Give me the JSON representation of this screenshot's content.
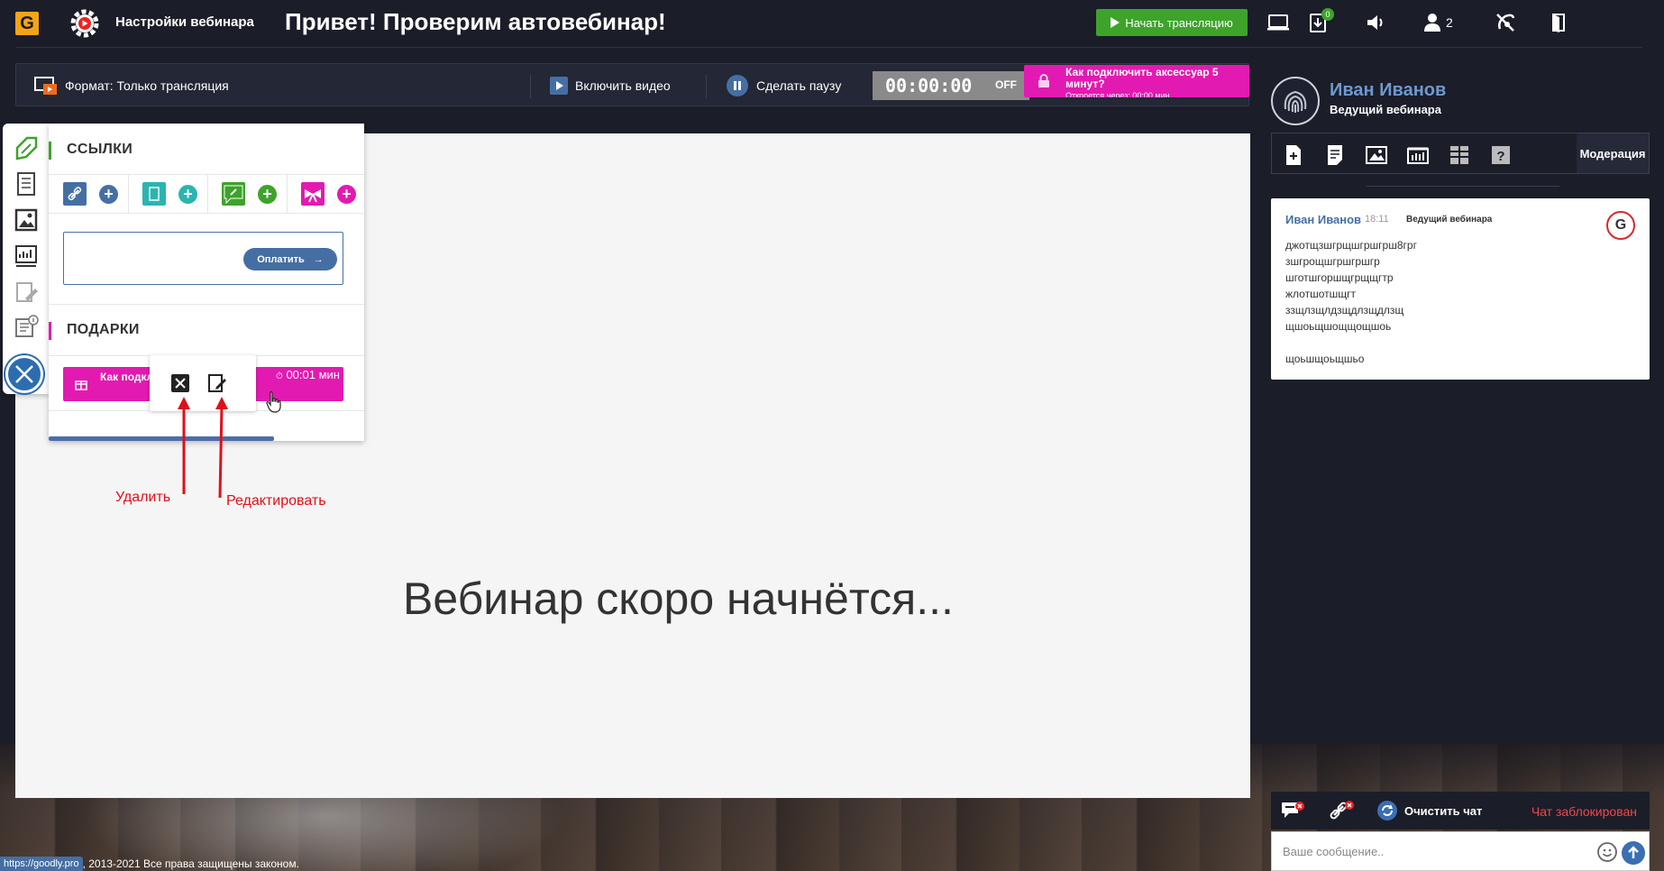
{
  "header": {
    "logo_letter": "G",
    "settings_label": "Настройки вебинара",
    "title": "Привет! Проверим автовебинар!",
    "start_button": "Начать трансляцию",
    "download_badge": "0",
    "users_count": "2",
    "icons": [
      "screen-share-icon",
      "download-icon",
      "volume-icon",
      "users-icon",
      "no-sound-icon",
      "exit-door-icon"
    ]
  },
  "controls": {
    "format_label": "Формат: Только трансляция",
    "enable_video": "Включить видео",
    "pause": "Сделать паузу",
    "timer": "00:00:00",
    "timer_state": "OFF",
    "promo_title": "Как подключить аксессуар 5 минут?",
    "promo_sub": "Откроется через: 00:00 мин"
  },
  "stage": {
    "message": "Вебинар скоро начнётся..."
  },
  "panel": {
    "links_title": "ССЫЛКИ",
    "gifts_title": "ПОДАРКИ",
    "pay_button": "Оплатить",
    "gift_title": "Как подключить аксессуар 5 минут?",
    "gift_title_visible": "Как подкл... 5 минут",
    "gift_time": "00:01 мин",
    "gift_time_icon": "⏱"
  },
  "annotations": {
    "delete_label": "Удалить",
    "edit_label": "Редактировать",
    "color": "#e0101a"
  },
  "presenter": {
    "name": "Иван Иванов",
    "role": "Ведущий вебинара"
  },
  "chat": {
    "moderation_tab": "Модерация",
    "message": {
      "author": "Иван Иванов",
      "time": "18:11",
      "role": "Ведущий вебинара",
      "lines": [
        "джотщзшгрщшгршгрш8грг",
        "зшгрощшгршгршгр",
        "шготшгоршщгрщщгтр",
        "жлотшотшщгт",
        "ззщлзщлдзщдлзщдлзщ",
        "щшоьщшощщощшоь",
        "",
        "щоьшщоьщшьо"
      ]
    },
    "clear_chat": "Очистить чат",
    "chat_locked": "Чат заблокирован",
    "input_placeholder": "Ваше сообщение.."
  },
  "footer": {
    "url": "https://goodly.pro",
    "copyright": ", 2013-2021 Все права защищены законом."
  },
  "colors": {
    "accent_green": "#3ea32b",
    "accent_pink": "#e21ab1",
    "accent_blue": "#456fa3",
    "dark_bg": "#1b1d29"
  }
}
